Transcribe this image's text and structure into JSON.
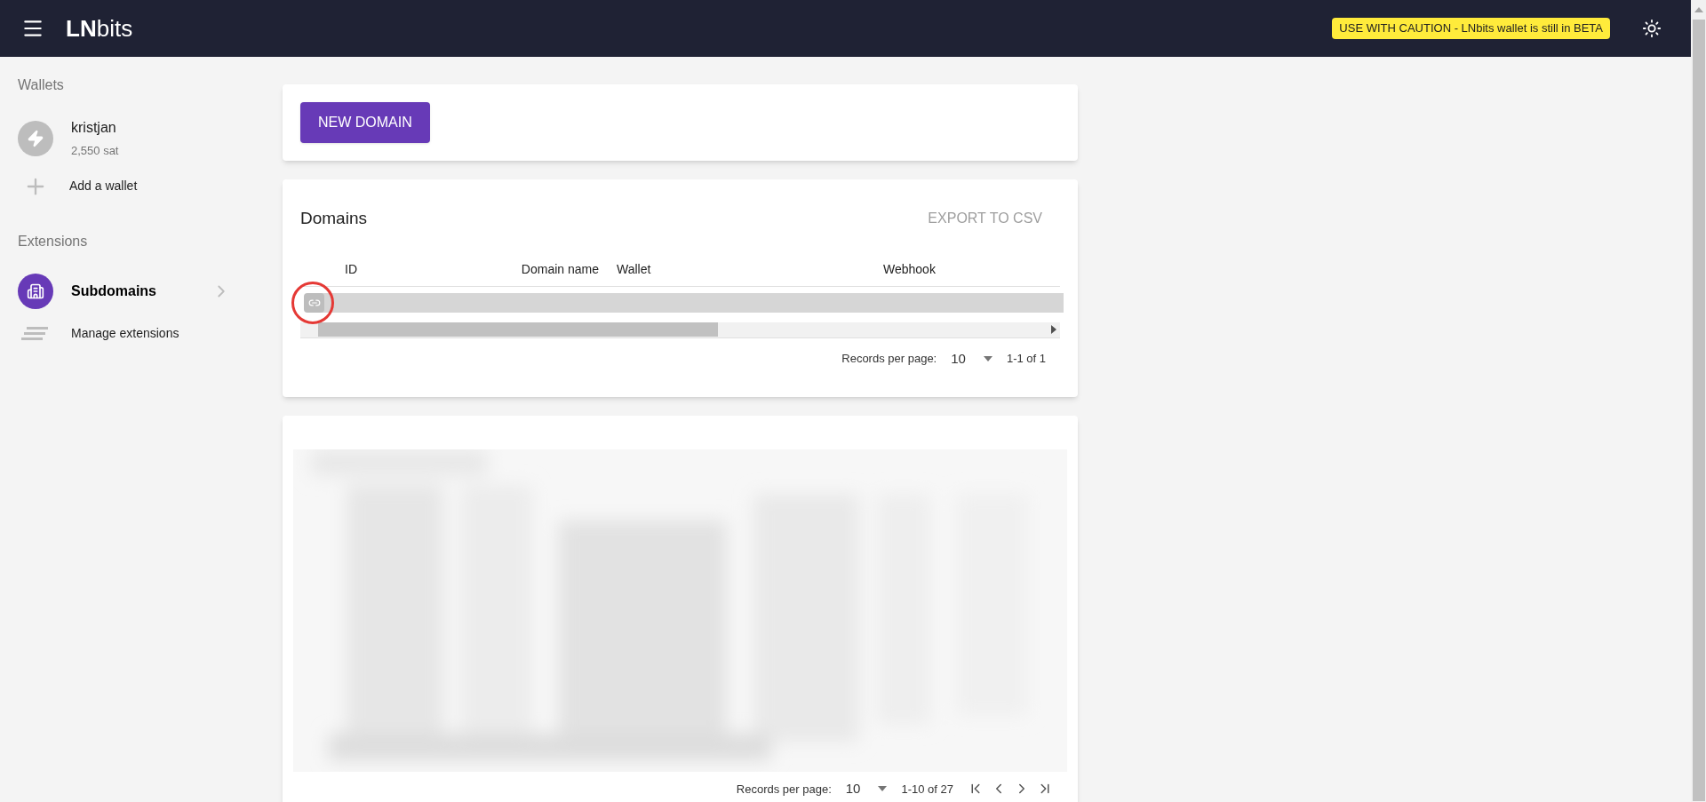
{
  "header": {
    "logo_bold": "LN",
    "logo_rest": "bits",
    "banner": "USE WITH CAUTION - LNbits wallet is still in BETA"
  },
  "sidebar": {
    "wallets_heading": "Wallets",
    "wallets": [
      {
        "name": "kristjan",
        "balance": "2,550 sat"
      }
    ],
    "add_wallet": "Add a wallet",
    "extensions_heading": "Extensions",
    "extensions": [
      {
        "name": "Subdomains",
        "selected": true
      }
    ],
    "manage_extensions": "Manage extensions"
  },
  "new_domain_button": "NEW DOMAIN",
  "domains": {
    "title": "Domains",
    "export": "EXPORT TO CSV",
    "columns": [
      "ID",
      "Domain name",
      "Wallet",
      "Webhook"
    ],
    "records_label": "Records per page:",
    "per_page": "10",
    "range": "1-1 of 1"
  },
  "subdomains": {
    "records_label": "Records per page:",
    "per_page": "10",
    "range": "1-10 of 27"
  }
}
